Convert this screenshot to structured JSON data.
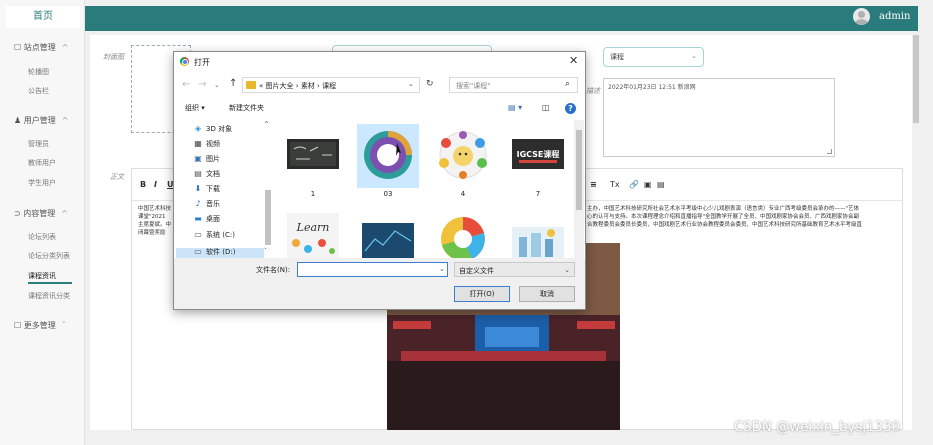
{
  "app": {
    "home_tab": "首页",
    "user": "admin"
  },
  "sidebar": {
    "groups": [
      {
        "label": "站点管理",
        "items": [
          "轮播图",
          "公告栏"
        ]
      },
      {
        "label": "用户管理",
        "items": [
          "管理员",
          "教师用户",
          "学生用户"
        ]
      },
      {
        "label": "内容管理",
        "items": [
          "论坛列表",
          "论坛分类列表",
          "课程资讯",
          "课程资讯分类"
        ]
      },
      {
        "label": "更多管理",
        "items": []
      }
    ],
    "active_item": "课程资讯"
  },
  "form": {
    "cover_label": "封面图",
    "body_label": "正文",
    "category_value": "课程",
    "description_label": "描述",
    "description_value": "2022年01月23日 12:51 新浪网"
  },
  "editor": {
    "toolbar_left": [
      "B",
      "I",
      "U"
    ],
    "toolbar_right": [
      "≡",
      "Tx",
      "🔗",
      "▣",
      "▤"
    ],
    "lines_left": [
      "中国艺术科技",
      "课堂\"2021",
      "主席夏斌。中",
      "闭幕暨奖励"
    ],
    "lines_right": [
      "主办，中国艺术科技研究所社会艺术水平考级中心少儿戏剧表演（语言类）专业广西考级委员会承办的——\"艺体",
      "心的认可与支持。本次课程理念介绍和直播指导\"全国教学开展了全员、中国戏剧家协会会员、广西戏剧家协会副",
      "合教程委员会委员长委员，中国戏剧艺术行业协会教程委员会委员、中国艺术科技研究所基础教育艺术水平考级直"
    ]
  },
  "dialog": {
    "title": "打开",
    "path": [
      "«",
      "图片大全",
      "›",
      "素材",
      "›",
      "课程"
    ],
    "search_placeholder": "搜索\"课程\"",
    "organize": "组织 ▾",
    "new_folder": "新建文件夹",
    "nav_items": [
      {
        "icon": "3d-objects-icon",
        "label": "3D 对象"
      },
      {
        "icon": "video-icon",
        "label": "视频"
      },
      {
        "icon": "pictures-icon",
        "label": "图片"
      },
      {
        "icon": "documents-icon",
        "label": "文档"
      },
      {
        "icon": "downloads-icon",
        "label": "下载"
      },
      {
        "icon": "music-icon",
        "label": "音乐"
      },
      {
        "icon": "desktop-icon",
        "label": "桌面"
      },
      {
        "icon": "drive-c-icon",
        "label": "系统 (C:)"
      },
      {
        "icon": "drive-d-icon",
        "label": "软件 (D:)"
      }
    ],
    "files": [
      {
        "name": "1",
        "thumb": "blackboard"
      },
      {
        "name": "03",
        "thumb": "circle-diagram",
        "selected": true
      },
      {
        "name": "4",
        "thumb": "kids-icons"
      },
      {
        "name": "7",
        "thumb": "igcse-course"
      },
      {
        "name": "",
        "thumb": "learn"
      },
      {
        "name": "",
        "thumb": "blue-tech"
      },
      {
        "name": "",
        "thumb": "colored-circle"
      },
      {
        "name": "",
        "thumb": "city-scene"
      }
    ],
    "igcse_text": "IGCSE课程",
    "learn_text": "Learn",
    "filename_label": "文件名(N):",
    "filename_value": "",
    "filetype_value": "自定义文件",
    "open_button": "打开(O)",
    "cancel_button": "取消"
  },
  "watermark": "CSDN @weixin_bysj1330",
  "colors": {
    "topbar": "#2a7b7b",
    "accent": "#2e7e7e",
    "dialog_selection": "#cce8ff"
  }
}
